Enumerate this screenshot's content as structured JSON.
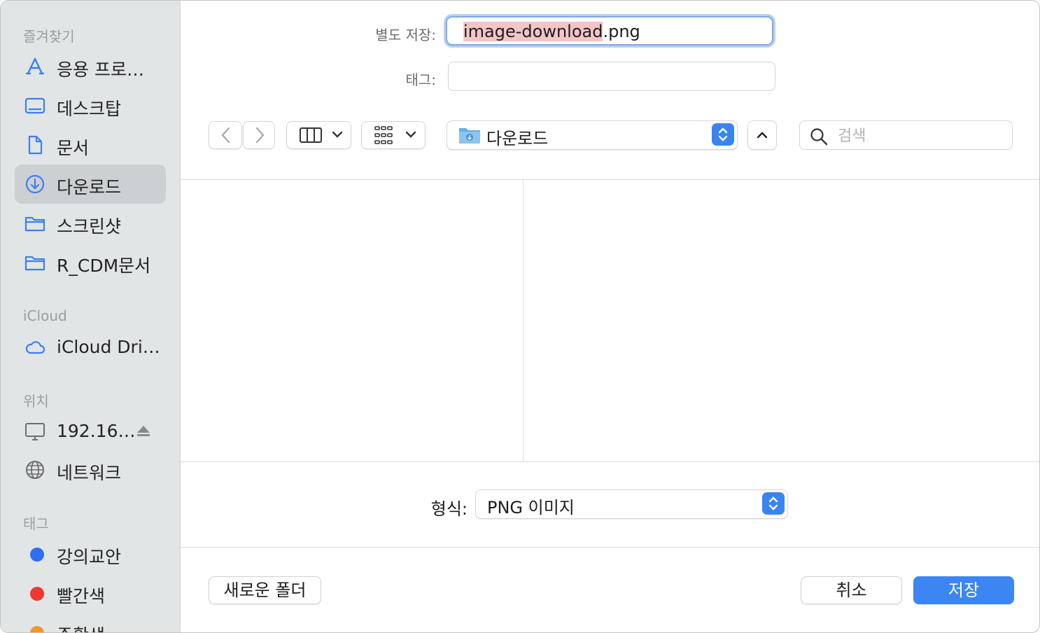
{
  "sidebar": {
    "favorites_title": "즐겨찾기",
    "favorites": [
      {
        "label": "응용 프로…",
        "icon": "applications-icon"
      },
      {
        "label": "데스크탑",
        "icon": "desktop-icon"
      },
      {
        "label": "문서",
        "icon": "document-icon"
      },
      {
        "label": "다운로드",
        "icon": "downloads-icon",
        "selected": true
      },
      {
        "label": "스크린샷",
        "icon": "folder-icon"
      },
      {
        "label": "R_CDM문서",
        "icon": "folder-icon"
      }
    ],
    "icloud_title": "iCloud",
    "icloud_item": {
      "label": "iCloud Dri…",
      "icon": "cloud-icon"
    },
    "locations_title": "위치",
    "locations": [
      {
        "label": "192.16…",
        "icon": "monitor-icon"
      },
      {
        "label": "네트워크",
        "icon": "globe-icon"
      }
    ],
    "tags_title": "태그",
    "tags": [
      {
        "label": "강의교안",
        "color": "#2f6ff0"
      },
      {
        "label": "빨간색",
        "color": "#f0382e"
      },
      {
        "label": "주황색",
        "color": "#f5962a"
      }
    ]
  },
  "form": {
    "save_as_label": "별도 저장:",
    "filename_selected": "image-download",
    "filename_ext": ".png",
    "tags_label": "태그:"
  },
  "toolbar": {
    "location": "다운로드",
    "search_placeholder": "검색"
  },
  "format": {
    "label": "형식:",
    "value": "PNG 이미지"
  },
  "buttons": {
    "new_folder": "새로운 폴더",
    "cancel": "취소",
    "save": "저장"
  },
  "colors": {
    "accent": "#3b86f2",
    "selection": "#f4c5c8",
    "sidebar_bg": "#e2e5e6"
  }
}
